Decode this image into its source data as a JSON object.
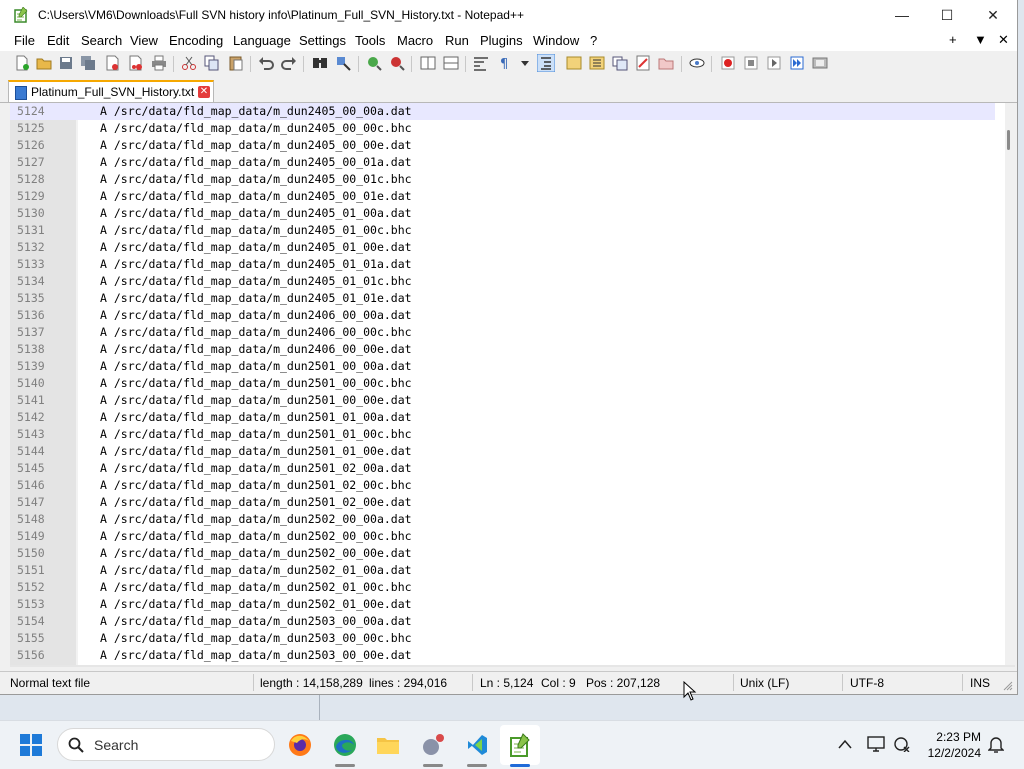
{
  "window": {
    "title": "C:\\Users\\VM6\\Downloads\\Full SVN history info\\Platinum_Full_SVN_History.txt - Notepad++",
    "minimize": "—",
    "maximize": "☐",
    "close": "✕"
  },
  "menu": {
    "items": [
      "File",
      "Edit",
      "Search",
      "View",
      "Encoding",
      "Language",
      "Settings",
      "Tools",
      "Macro",
      "Run",
      "Plugins",
      "Window",
      "?"
    ],
    "right": [
      "+",
      "▼",
      "✕"
    ]
  },
  "tab": {
    "label": "Platinum_Full_SVN_History.txt",
    "close": "✕"
  },
  "editor": {
    "lines": [
      {
        "num": "5124",
        "text": "A /src/data/fld_map_data/m_dun2405_00_00a.dat"
      },
      {
        "num": "5125",
        "text": "A /src/data/fld_map_data/m_dun2405_00_00c.bhc"
      },
      {
        "num": "5126",
        "text": "A /src/data/fld_map_data/m_dun2405_00_00e.dat"
      },
      {
        "num": "5127",
        "text": "A /src/data/fld_map_data/m_dun2405_00_01a.dat"
      },
      {
        "num": "5128",
        "text": "A /src/data/fld_map_data/m_dun2405_00_01c.bhc"
      },
      {
        "num": "5129",
        "text": "A /src/data/fld_map_data/m_dun2405_00_01e.dat"
      },
      {
        "num": "5130",
        "text": "A /src/data/fld_map_data/m_dun2405_01_00a.dat"
      },
      {
        "num": "5131",
        "text": "A /src/data/fld_map_data/m_dun2405_01_00c.bhc"
      },
      {
        "num": "5132",
        "text": "A /src/data/fld_map_data/m_dun2405_01_00e.dat"
      },
      {
        "num": "5133",
        "text": "A /src/data/fld_map_data/m_dun2405_01_01a.dat"
      },
      {
        "num": "5134",
        "text": "A /src/data/fld_map_data/m_dun2405_01_01c.bhc"
      },
      {
        "num": "5135",
        "text": "A /src/data/fld_map_data/m_dun2405_01_01e.dat"
      },
      {
        "num": "5136",
        "text": "A /src/data/fld_map_data/m_dun2406_00_00a.dat"
      },
      {
        "num": "5137",
        "text": "A /src/data/fld_map_data/m_dun2406_00_00c.bhc"
      },
      {
        "num": "5138",
        "text": "A /src/data/fld_map_data/m_dun2406_00_00e.dat"
      },
      {
        "num": "5139",
        "text": "A /src/data/fld_map_data/m_dun2501_00_00a.dat"
      },
      {
        "num": "5140",
        "text": "A /src/data/fld_map_data/m_dun2501_00_00c.bhc"
      },
      {
        "num": "5141",
        "text": "A /src/data/fld_map_data/m_dun2501_00_00e.dat"
      },
      {
        "num": "5142",
        "text": "A /src/data/fld_map_data/m_dun2501_01_00a.dat"
      },
      {
        "num": "5143",
        "text": "A /src/data/fld_map_data/m_dun2501_01_00c.bhc"
      },
      {
        "num": "5144",
        "text": "A /src/data/fld_map_data/m_dun2501_01_00e.dat"
      },
      {
        "num": "5145",
        "text": "A /src/data/fld_map_data/m_dun2501_02_00a.dat"
      },
      {
        "num": "5146",
        "text": "A /src/data/fld_map_data/m_dun2501_02_00c.bhc"
      },
      {
        "num": "5147",
        "text": "A /src/data/fld_map_data/m_dun2501_02_00e.dat"
      },
      {
        "num": "5148",
        "text": "A /src/data/fld_map_data/m_dun2502_00_00a.dat"
      },
      {
        "num": "5149",
        "text": "A /src/data/fld_map_data/m_dun2502_00_00c.bhc"
      },
      {
        "num": "5150",
        "text": "A /src/data/fld_map_data/m_dun2502_00_00e.dat"
      },
      {
        "num": "5151",
        "text": "A /src/data/fld_map_data/m_dun2502_01_00a.dat"
      },
      {
        "num": "5152",
        "text": "A /src/data/fld_map_data/m_dun2502_01_00c.bhc"
      },
      {
        "num": "5153",
        "text": "A /src/data/fld_map_data/m_dun2502_01_00e.dat"
      },
      {
        "num": "5154",
        "text": "A /src/data/fld_map_data/m_dun2503_00_00a.dat"
      },
      {
        "num": "5155",
        "text": "A /src/data/fld_map_data/m_dun2503_00_00c.bhc"
      },
      {
        "num": "5156",
        "text": "A /src/data/fld_map_data/m_dun2503_00_00e.dat"
      }
    ]
  },
  "status": {
    "file_type": "Normal text file",
    "length": "length : 14,158,289",
    "lines": "lines : 294,016",
    "ln": "Ln : 5,124",
    "col": "Col : 9",
    "pos": "Pos : 207,128",
    "eol": "Unix (LF)",
    "encoding": "UTF-8",
    "mode": "INS"
  },
  "taskbar": {
    "search_placeholder": "Search",
    "time": "2:23 PM",
    "date": "12/2/2024"
  }
}
